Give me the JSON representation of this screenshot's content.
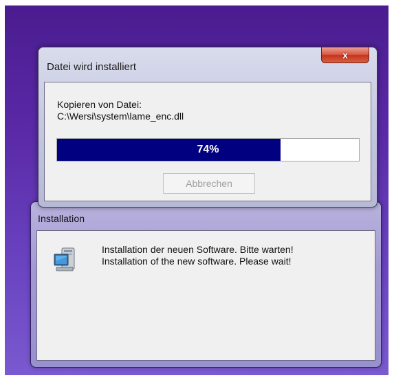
{
  "install_window": {
    "title": "Installation",
    "icon": "computer-install-icon",
    "message_de": "Installation der neuen Software. Bitte warten!",
    "message_en": "Installation of the new software. Please wait!"
  },
  "copy_dialog": {
    "title": "Datei wird installiert",
    "close_label": "x",
    "copy_label": "Kopieren von Datei:",
    "file_path": "C:\\Wersi\\system\\lame_enc.dll",
    "progress_percent": 74,
    "progress_text": "74%",
    "cancel_label": "Abbrechen",
    "cancel_enabled": false
  },
  "colors": {
    "desktop_background": "#5a2aa8",
    "progress_fill": "#000080",
    "close_button": "#c2351f"
  }
}
